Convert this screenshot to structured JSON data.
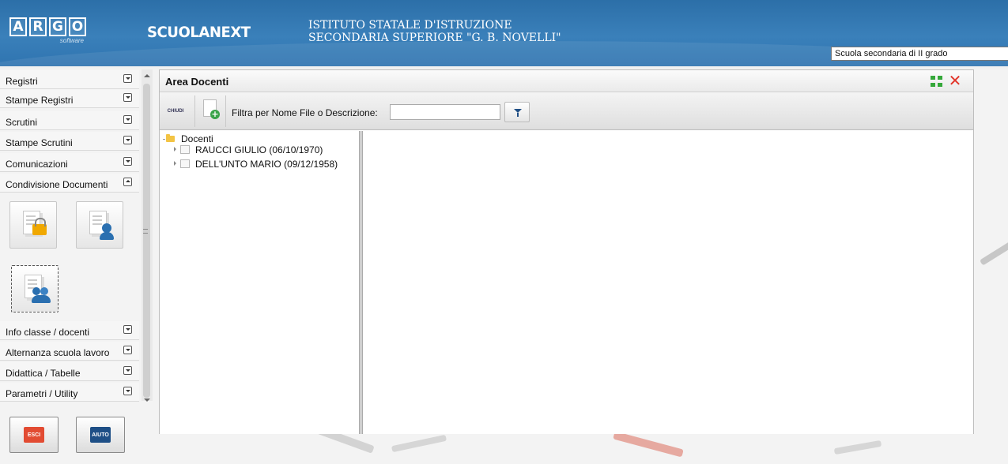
{
  "header": {
    "logo_letters": [
      "A",
      "R",
      "G",
      "O"
    ],
    "logo_sub": "software",
    "brand": "SCUOLANEXT",
    "school_line1": "ISTITUTO STATALE D'ISTRUZIONE",
    "school_line2": "SECONDARIA SUPERIORE \"G. B. NOVELLI\"",
    "school_select_value": "Scuola secondaria di II grado"
  },
  "sidebar": {
    "items": [
      {
        "label": "Registri"
      },
      {
        "label": "Stampe Registri"
      },
      {
        "label": "Scrutini"
      },
      {
        "label": "Stampe Scrutini"
      },
      {
        "label": "Comunicazioni"
      },
      {
        "label": "Condivisione Documenti"
      },
      {
        "label": "Info classe / docenti"
      },
      {
        "label": "Alternanza scuola lavoro"
      },
      {
        "label": "Didattica / Tabelle"
      },
      {
        "label": "Parametri / Utility"
      }
    ],
    "exit_label": "ESCI",
    "help_label": "AIUTO"
  },
  "panel": {
    "title": "Area Docenti",
    "close_label": "CHIUDI",
    "filter_label": "Filtra per Nome File o Descrizione:",
    "filter_value": ""
  },
  "tree": {
    "root": "Docenti",
    "children": [
      {
        "label": "RAUCCI GIULIO (06/10/1970)"
      },
      {
        "label": "DELL'UNTO MARIO (09/12/1958)"
      }
    ]
  },
  "colors": {
    "header_blue": "#2f74b0",
    "close_red": "#e2362b",
    "exit_red": "#e24b32",
    "help_blue": "#1e4f86",
    "add_green": "#3aa34a"
  }
}
